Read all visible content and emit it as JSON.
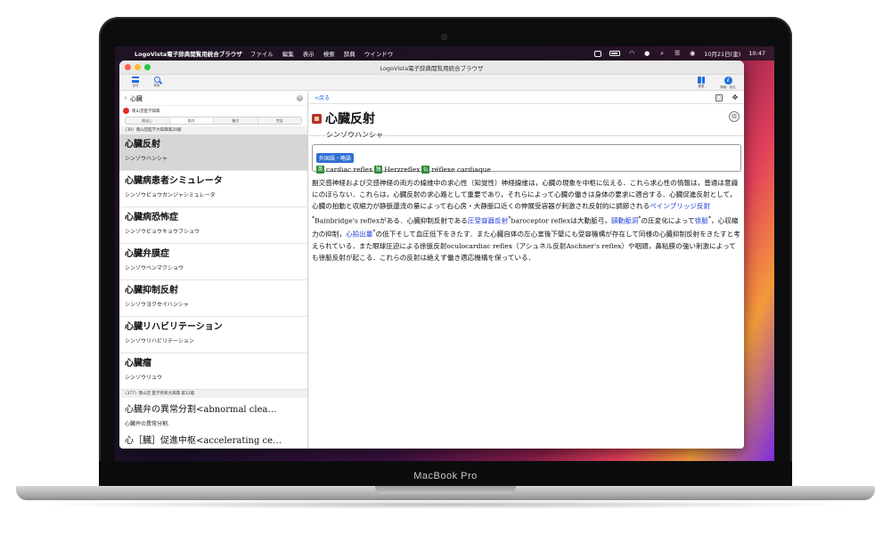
{
  "device": {
    "brand_label": "MacBook Pro"
  },
  "menubar": {
    "app_name": "LogoVista電子辞典閲覧用統合ブラウザ",
    "menus": [
      "ファイル",
      "編集",
      "表示",
      "検索",
      "辞典",
      "ウインドウ"
    ],
    "date": "10月21日(金)",
    "time": "10:47"
  },
  "window": {
    "title": "LogoVista電子辞典閲覧用統合ブラウザ",
    "toolbar": {
      "menu_label": "目次",
      "search_label": "検索",
      "history_label": "履歴",
      "info_label": "情報・設定"
    }
  },
  "sidebar": {
    "search_value": "心臓",
    "dictionary_name": "南山堂医学辞典",
    "tabs": [
      "前出し",
      "前方",
      "後方",
      "完全"
    ],
    "active_tab": 1,
    "section1_header": "〈30〉南山堂医学大辞典第20版",
    "results": [
      {
        "title": "心臓反射",
        "reading": "シンゾウハンシャ"
      },
      {
        "title": "心臓病患者シミュレータ",
        "reading": "シンゾウビョウカンジャシミュレータ"
      },
      {
        "title": "心臓病恐怖症",
        "reading": "シンゾウビョウキョウフショウ"
      },
      {
        "title": "心臓弁膜症",
        "reading": "シンゾウベンマクショウ"
      },
      {
        "title": "心臓抑制反射",
        "reading": "シンゾウヨクセイハンシャ"
      },
      {
        "title": "心臓リハビリテーション",
        "reading": "シンゾウリハビリテーション"
      },
      {
        "title": "心臓瘤",
        "reading": "シンゾウリュウ"
      }
    ],
    "section2_header": "〈377〉南山堂 医学英和大辞典 第12版",
    "results2": [
      {
        "title": "心臓弁の異常分割<abnormal clea…",
        "sub": ""
      },
      {
        "title": "",
        "sub": "心臓弁の異常分割."
      },
      {
        "title": "心［臓］促進中枢<accelerating ce…",
        "sub": ""
      }
    ]
  },
  "entry": {
    "back_label": "<戻る",
    "headword": "心臓反射",
    "reading": "シンゾウハンシャ",
    "foreign_tag": "外国語・略語",
    "foreign": [
      {
        "badge": "英",
        "term": "cardiac reflex"
      },
      {
        "badge": "独",
        "term": "Herzreflex"
      },
      {
        "badge": "仏",
        "term": "réflexe cardiaque"
      }
    ],
    "definition": {
      "p1": "副交感神経および交感神経の両方の線維中の求心性（知覚性）神経線維は，心臓の現象を中枢に伝える．これら求心性の情報は，普通は意識にのぼらない．これらは，心臓反射の求心路として重要であり，それらによって心臓の働きは身体の要求に適合する．心臓促進反射として，心臓の拍動と収縮力が静脈還流の量によって右心房・大静脈口近くの伸展受容器が刺激され反射的に調節される",
      "link1": "ベインブリッジ反射",
      "latin1": "Bainbridge's reflex",
      "t2": "がある．心臓抑制反射である",
      "link2": "圧受容器反射",
      "latin2": "baroceptor reflex",
      "t3": "は大動脈弓，",
      "link3": "頸動脈洞",
      "t4": "の圧変化によって",
      "link4": "徐脈",
      "t5": "，心収縮力の抑制，",
      "link5": "心拍出量",
      "t6": "の低下そして血圧低下をきたす．また心臓自体の左心室後下壁にも受容機構が存在して同様の心臓抑制反射をきたすと考えられている．また眼球圧迫による徐脈反射",
      "latin3": "oculocardiac reflex",
      "t7": "（アシュネル反射",
      "latin4": "Aschner's reflex",
      "t8": "）や咽頭，鼻粘膜の強い刺激によっても徐脈反射が起こる．これらの反射は絶えず働き適応機構を保っている．"
    }
  }
}
